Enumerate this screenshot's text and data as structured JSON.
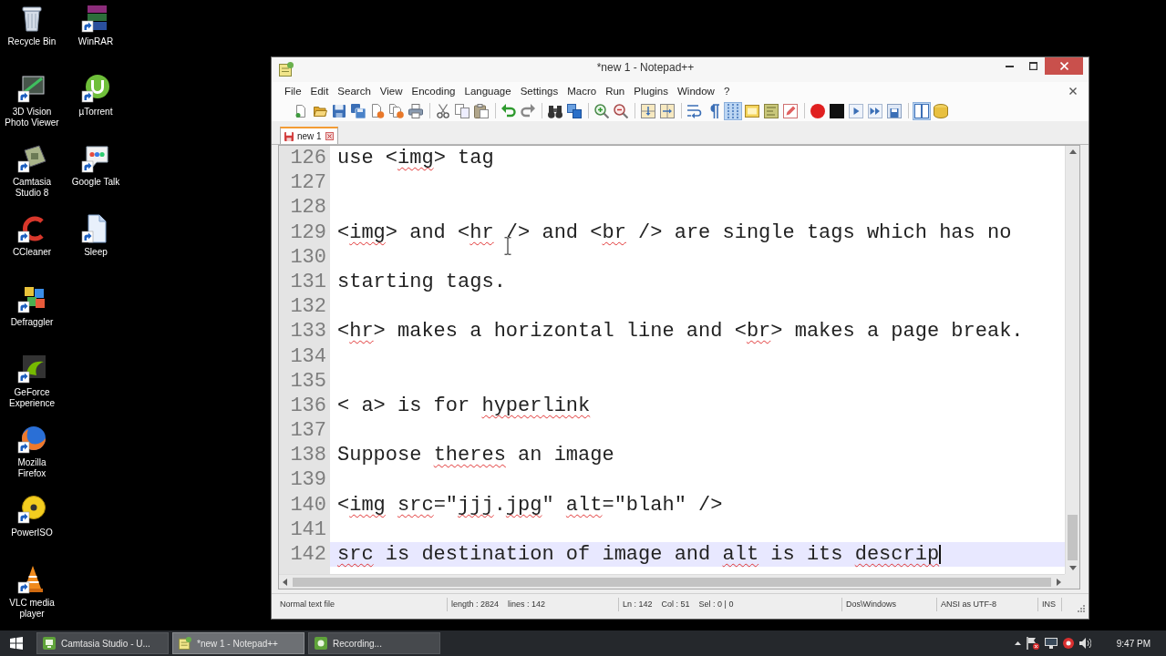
{
  "desktop_icons": [
    {
      "label": "Recycle Bin"
    },
    {
      "label": "3D Vision Photo Viewer"
    },
    {
      "label": "Camtasia Studio 8"
    },
    {
      "label": "CCleaner"
    },
    {
      "label": "Defraggler"
    },
    {
      "label": "GeForce Experience"
    },
    {
      "label": "Mozilla Firefox"
    },
    {
      "label": "PowerISO"
    },
    {
      "label": "VLC media player"
    },
    {
      "label": "WinRAR"
    },
    {
      "label": "µTorrent"
    },
    {
      "label": "Google Talk"
    },
    {
      "label": "Sleep"
    }
  ],
  "window": {
    "title": "*new 1 - Notepad++"
  },
  "menu": [
    "File",
    "Edit",
    "Search",
    "View",
    "Encoding",
    "Language",
    "Settings",
    "Macro",
    "Run",
    "Plugins",
    "Window",
    "?"
  ],
  "toolbar": [
    [
      {
        "pressed": false
      },
      {
        "pressed": false
      },
      {
        "pressed": false
      },
      {
        "pressed": false
      },
      {
        "pressed": false
      },
      {
        "pressed": false
      },
      {
        "pressed": false
      }
    ],
    [
      {
        "pressed": false
      },
      {
        "pressed": false
      },
      {
        "pressed": false
      }
    ],
    [
      {
        "pressed": false
      },
      {
        "pressed": false
      }
    ],
    [
      {
        "pressed": false
      },
      {
        "pressed": false
      }
    ],
    [
      {
        "pressed": false
      },
      {
        "pressed": false
      }
    ],
    [
      {
        "pressed": false
      },
      {
        "pressed": false
      }
    ],
    [
      {
        "pressed": false
      },
      {
        "pressed": false
      },
      {
        "pressed": true
      },
      {
        "pressed": false
      },
      {
        "pressed": false
      },
      {
        "pressed": false
      }
    ],
    [
      {
        "pressed": false
      },
      {
        "pressed": false
      },
      {
        "pressed": false
      },
      {
        "pressed": false
      },
      {
        "pressed": false
      }
    ],
    [
      {
        "pressed": true
      },
      {
        "pressed": false
      }
    ]
  ],
  "tabs": [
    {
      "label": "new 1",
      "selected": true,
      "modified": true
    }
  ],
  "editor": {
    "lines": [
      {
        "number": "126",
        "current": false,
        "segments": [
          {
            "text": "use <",
            "misspelled": false
          },
          {
            "text": "img",
            "misspelled": true
          },
          {
            "text": "> tag",
            "misspelled": false
          }
        ]
      },
      {
        "number": "127",
        "current": false
      },
      {
        "number": "128",
        "current": false
      },
      {
        "number": "129",
        "current": false,
        "segments": [
          {
            "text": "<",
            "misspelled": false
          },
          {
            "text": "img",
            "misspelled": true
          },
          {
            "text": "> and <",
            "misspelled": false
          },
          {
            "text": "hr",
            "misspelled": true
          },
          {
            "text": " /> and <",
            "misspelled": false
          },
          {
            "text": "br",
            "misspelled": true
          },
          {
            "text": " /> are single tags which has no",
            "misspelled": false
          }
        ]
      },
      {
        "number": "130",
        "current": false
      },
      {
        "number": "131",
        "current": false,
        "segments": [
          {
            "text": "starting tags.",
            "misspelled": false
          }
        ]
      },
      {
        "number": "132",
        "current": false
      },
      {
        "number": "133",
        "current": false,
        "segments": [
          {
            "text": "<",
            "misspelled": false
          },
          {
            "text": "hr",
            "misspelled": true
          },
          {
            "text": "> makes a horizontal line and <",
            "misspelled": false
          },
          {
            "text": "br",
            "misspelled": true
          },
          {
            "text": "> makes a page break.",
            "misspelled": false
          }
        ]
      },
      {
        "number": "134",
        "current": false
      },
      {
        "number": "135",
        "current": false
      },
      {
        "number": "136",
        "current": false,
        "segments": [
          {
            "text": "< a> is for ",
            "misspelled": false
          },
          {
            "text": "hyperlink",
            "misspelled": true
          }
        ]
      },
      {
        "number": "137",
        "current": false
      },
      {
        "number": "138",
        "current": false,
        "segments": [
          {
            "text": "Suppose ",
            "misspelled": false
          },
          {
            "text": "theres",
            "misspelled": true
          },
          {
            "text": " an image",
            "misspelled": false
          }
        ]
      },
      {
        "number": "139",
        "current": false
      },
      {
        "number": "140",
        "current": false,
        "segments": [
          {
            "text": "<",
            "misspelled": false
          },
          {
            "text": "img",
            "misspelled": true
          },
          {
            "text": " src",
            "misspelled": true
          },
          {
            "text": "=\"",
            "misspelled": false
          },
          {
            "text": "jjj",
            "misspelled": true
          },
          {
            "text": ".",
            "misspelled": false
          },
          {
            "text": "jpg",
            "misspelled": true
          },
          {
            "text": "\" ",
            "misspelled": false
          },
          {
            "text": "alt",
            "misspelled": true
          },
          {
            "text": "=\"blah\" />",
            "misspelled": false
          }
        ]
      },
      {
        "number": "141",
        "current": false
      },
      {
        "number": "142",
        "current": true,
        "segments": [
          {
            "text": "src",
            "misspelled": true
          },
          {
            "text": " is destination of image and ",
            "misspelled": false
          },
          {
            "text": "alt",
            "misspelled": true
          },
          {
            "text": " is its ",
            "misspelled": false
          },
          {
            "text": "descrip",
            "misspelled": true
          }
        ]
      }
    ]
  },
  "status_bar": [
    "Normal text file",
    "length : 2824    lines : 142",
    "Ln : 142    Col : 51    Sel : 0 | 0",
    "Dos\\Windows",
    "ANSI as UTF-8",
    "INS"
  ],
  "taskbar": {
    "tasks": [
      {
        "label": "Camtasia Studio - U...",
        "active": false
      },
      {
        "label": "*new 1 - Notepad++",
        "active": true
      },
      {
        "label": "Recording...",
        "active": false
      }
    ],
    "clock": "9:47 PM"
  }
}
